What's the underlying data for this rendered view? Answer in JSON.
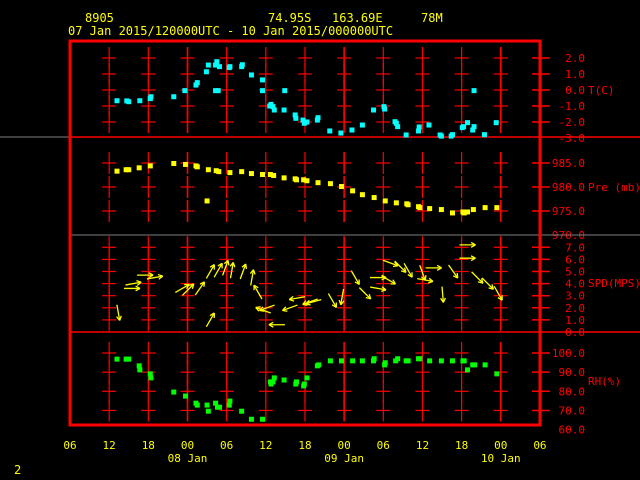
{
  "header": {
    "station": "8905",
    "lat": "74.95S",
    "lon": "163.69E",
    "elev": "78M",
    "period": "07 Jan 2015/120000UTC - 10 Jan 2015/000000UTC"
  },
  "page_number": "2",
  "colors": {
    "frame": "#ff0000",
    "axis_text": "#ff0000",
    "time_text": "#ffff00",
    "temp": "#00ffff",
    "pres": "#ffff00",
    "wind": "#ffff00",
    "rh": "#00ff00"
  },
  "chart_data": {
    "type": "scatter",
    "title": "",
    "x_unit": "hours since 07 Jan 06 UTC",
    "xlim": [
      0,
      72
    ],
    "x_ticks": [
      {
        "h": 0,
        "label": "06"
      },
      {
        "h": 6,
        "label": "12"
      },
      {
        "h": 12,
        "label": "18"
      },
      {
        "h": 18,
        "label": "00"
      },
      {
        "h": 24,
        "label": "06"
      },
      {
        "h": 30,
        "label": "12"
      },
      {
        "h": 36,
        "label": "18"
      },
      {
        "h": 42,
        "label": "00"
      },
      {
        "h": 48,
        "label": "06"
      },
      {
        "h": 54,
        "label": "12"
      },
      {
        "h": 60,
        "label": "18"
      },
      {
        "h": 66,
        "label": "00"
      },
      {
        "h": 72,
        "label": "06"
      }
    ],
    "date_labels": [
      {
        "h": 18,
        "label": "08 Jan"
      },
      {
        "h": 42,
        "label": "09 Jan"
      },
      {
        "h": 66,
        "label": "10 Jan"
      }
    ],
    "panels": [
      {
        "id": "temp",
        "ylabel": "T(C)",
        "ylim": [
          -3,
          3
        ],
        "ticks": [
          "2.0",
          "1.0",
          "0.0",
          "-1.0",
          "-2.0",
          "-3.0"
        ],
        "tick_values": [
          2,
          1,
          0,
          -1,
          -2,
          -3
        ],
        "points": [
          [
            7.2,
            -0.67
          ],
          [
            8.7,
            -0.68
          ],
          [
            9.0,
            -0.73
          ],
          [
            10.7,
            -0.67
          ],
          [
            12.3,
            -0.54
          ],
          [
            12.4,
            -0.42
          ],
          [
            15.9,
            -0.42
          ],
          [
            17.6,
            -0.04
          ],
          [
            19.3,
            0.31
          ],
          [
            19.5,
            0.46
          ],
          [
            20.9,
            1.14
          ],
          [
            21.2,
            1.56
          ],
          [
            22.3,
            1.56
          ],
          [
            22.5,
            1.77
          ],
          [
            22.9,
            1.46
          ],
          [
            22.3,
            -0.04
          ],
          [
            22.7,
            -0.04
          ],
          [
            24.4,
            1.4
          ],
          [
            24.5,
            1.46
          ],
          [
            26.3,
            1.46
          ],
          [
            26.4,
            1.58
          ],
          [
            27.8,
            0.94
          ],
          [
            29.5,
            0.63
          ],
          [
            29.5,
            -0.04
          ],
          [
            30.8,
            -0.9
          ],
          [
            30.6,
            -1.0
          ],
          [
            31.1,
            -1.04
          ],
          [
            31.3,
            -1.25
          ],
          [
            32.9,
            -0.04
          ],
          [
            32.8,
            -1.25
          ],
          [
            34.5,
            -1.56
          ],
          [
            34.6,
            -1.77
          ],
          [
            35.7,
            -1.88
          ],
          [
            35.9,
            -2.08
          ],
          [
            36.3,
            -2.0
          ],
          [
            37.9,
            -1.88
          ],
          [
            38.0,
            -1.73
          ],
          [
            39.8,
            -2.56
          ],
          [
            41.5,
            -2.69
          ],
          [
            43.2,
            -2.5
          ],
          [
            44.8,
            -2.19
          ],
          [
            46.5,
            -1.25
          ],
          [
            48.1,
            -1.04
          ],
          [
            48.2,
            -1.19
          ],
          [
            49.8,
            -1.98
          ],
          [
            50.0,
            -2.08
          ],
          [
            50.2,
            -2.29
          ],
          [
            51.5,
            -2.81
          ],
          [
            53.4,
            -2.56
          ],
          [
            53.5,
            -2.31
          ],
          [
            55.0,
            -2.19
          ],
          [
            56.7,
            -2.81
          ],
          [
            56.9,
            -2.88
          ],
          [
            58.4,
            -2.88
          ],
          [
            58.6,
            -2.79
          ],
          [
            60.1,
            -2.35
          ],
          [
            60.3,
            -2.29
          ],
          [
            60.9,
            -2.04
          ],
          [
            61.7,
            -2.5
          ],
          [
            61.9,
            -2.29
          ],
          [
            61.9,
            -0.04
          ],
          [
            63.5,
            -2.79
          ],
          [
            65.3,
            -2.04
          ]
        ]
      },
      {
        "id": "pres",
        "ylabel": "Pre (mb)",
        "ylim": [
          970,
          990
        ],
        "ticks": [
          "985.0",
          "980.0",
          "975.0",
          "970.0"
        ],
        "tick_values": [
          985,
          980,
          975,
          970
        ],
        "points": [
          [
            7.2,
            983.3
          ],
          [
            8.6,
            983.6
          ],
          [
            9.0,
            983.6
          ],
          [
            10.6,
            984.0
          ],
          [
            12.3,
            984.4
          ],
          [
            15.9,
            984.9
          ],
          [
            17.7,
            984.7
          ],
          [
            19.3,
            984.4
          ],
          [
            19.5,
            984.2
          ],
          [
            21.0,
            977.1
          ],
          [
            21.2,
            983.6
          ],
          [
            22.4,
            983.4
          ],
          [
            22.8,
            983.2
          ],
          [
            24.5,
            983.0
          ],
          [
            26.3,
            983.2
          ],
          [
            27.8,
            982.8
          ],
          [
            29.5,
            982.6
          ],
          [
            30.7,
            982.6
          ],
          [
            31.2,
            982.4
          ],
          [
            32.8,
            981.9
          ],
          [
            34.5,
            981.7
          ],
          [
            34.7,
            981.5
          ],
          [
            35.8,
            981.5
          ],
          [
            36.3,
            981.3
          ],
          [
            38.0,
            980.9
          ],
          [
            39.9,
            980.7
          ],
          [
            41.6,
            980.1
          ],
          [
            43.3,
            979.2
          ],
          [
            44.8,
            978.4
          ],
          [
            46.6,
            977.8
          ],
          [
            48.3,
            977.1
          ],
          [
            50.0,
            976.7
          ],
          [
            51.6,
            976.5
          ],
          [
            51.8,
            976.3
          ],
          [
            53.4,
            975.9
          ],
          [
            53.6,
            975.7
          ],
          [
            55.1,
            975.5
          ],
          [
            56.9,
            975.3
          ],
          [
            58.6,
            974.6
          ],
          [
            60.2,
            974.8
          ],
          [
            60.4,
            974.6
          ],
          [
            60.9,
            974.8
          ],
          [
            61.8,
            975.3
          ],
          [
            63.6,
            975.7
          ],
          [
            65.4,
            975.7
          ]
        ]
      },
      {
        "id": "wind",
        "ylabel": "SPD(MPS)",
        "ylim": [
          0,
          8
        ],
        "ticks": [
          "7.0",
          "6.0",
          "5.0",
          "4.0",
          "3.0",
          "2.0",
          "1.0",
          "0.0"
        ],
        "tick_values": [
          7,
          6,
          5,
          4,
          3,
          2,
          1,
          0
        ],
        "arrows_note": "[hour, speed m/s, direction arrow points toward (deg from north)]",
        "arrows": [
          [
            7.4,
            1.6,
            170
          ],
          [
            9.5,
            3.6,
            90
          ],
          [
            9.7,
            4.0,
            80
          ],
          [
            11.5,
            4.7,
            90
          ],
          [
            13.0,
            4.5,
            80
          ],
          [
            17.2,
            3.6,
            60
          ],
          [
            18.1,
            3.5,
            45
          ],
          [
            19.9,
            3.6,
            35
          ],
          [
            21.5,
            1.0,
            30
          ],
          [
            21.5,
            5.0,
            30
          ],
          [
            22.7,
            5.1,
            30
          ],
          [
            23.8,
            5.3,
            20
          ],
          [
            24.8,
            5.1,
            10
          ],
          [
            26.5,
            5.0,
            20
          ],
          [
            27.9,
            4.5,
            10
          ],
          [
            28.8,
            3.3,
            330
          ],
          [
            29.6,
            1.8,
            290
          ],
          [
            30.2,
            2.0,
            250
          ],
          [
            31.7,
            0.6,
            270
          ],
          [
            33.7,
            2.0,
            250
          ],
          [
            34.8,
            2.8,
            260
          ],
          [
            36.8,
            2.5,
            250
          ],
          [
            37.3,
            2.5,
            255
          ],
          [
            40.2,
            2.6,
            150
          ],
          [
            41.7,
            2.9,
            190
          ],
          [
            43.7,
            4.5,
            150
          ],
          [
            45.2,
            3.2,
            135
          ],
          [
            47.2,
            4.5,
            90
          ],
          [
            47.2,
            3.6,
            100
          ],
          [
            48.8,
            4.3,
            120
          ],
          [
            49.1,
            5.7,
            110
          ],
          [
            50.6,
            5.4,
            135
          ],
          [
            51.8,
            5.1,
            150
          ],
          [
            54.0,
            4.9,
            160
          ],
          [
            54.4,
            4.3,
            100
          ],
          [
            55.7,
            5.3,
            90
          ],
          [
            57.1,
            3.1,
            175
          ],
          [
            58.7,
            5.0,
            145
          ],
          [
            60.9,
            6.1,
            90
          ],
          [
            60.9,
            7.2,
            90
          ],
          [
            62.4,
            4.5,
            135
          ],
          [
            64.0,
            4.0,
            135
          ],
          [
            65.6,
            3.2,
            150
          ]
        ]
      },
      {
        "id": "rh",
        "ylabel": "RH(%)",
        "ylim": [
          60,
          110
        ],
        "ticks": [
          "100.0",
          "90.0",
          "80.0",
          "70.0",
          "60.0"
        ],
        "tick_values": [
          100,
          90,
          80,
          70,
          60
        ],
        "points": [
          [
            7.2,
            96.8
          ],
          [
            8.6,
            96.8
          ],
          [
            9.0,
            96.8
          ],
          [
            10.6,
            93.3
          ],
          [
            10.7,
            91.2
          ],
          [
            12.3,
            89.1
          ],
          [
            12.4,
            87.0
          ],
          [
            15.9,
            79.6
          ],
          [
            17.7,
            77.5
          ],
          [
            19.3,
            73.8
          ],
          [
            19.5,
            72.8
          ],
          [
            21.0,
            72.8
          ],
          [
            21.2,
            69.6
          ],
          [
            22.3,
            73.8
          ],
          [
            22.6,
            71.7
          ],
          [
            22.9,
            71.7
          ],
          [
            24.4,
            72.8
          ],
          [
            24.5,
            74.9
          ],
          [
            26.3,
            69.6
          ],
          [
            27.8,
            65.4
          ],
          [
            29.5,
            65.4
          ],
          [
            30.7,
            84.9
          ],
          [
            30.8,
            83.8
          ],
          [
            31.1,
            84.9
          ],
          [
            31.3,
            87.0
          ],
          [
            32.8,
            85.9
          ],
          [
            34.6,
            83.8
          ],
          [
            34.7,
            84.9
          ],
          [
            35.8,
            82.8
          ],
          [
            35.9,
            83.8
          ],
          [
            36.3,
            87.0
          ],
          [
            37.9,
            93.3
          ],
          [
            38.1,
            93.8
          ],
          [
            39.9,
            95.9
          ],
          [
            41.6,
            95.9
          ],
          [
            43.3,
            95.9
          ],
          [
            44.8,
            95.9
          ],
          [
            46.5,
            95.9
          ],
          [
            46.6,
            97.0
          ],
          [
            48.2,
            93.8
          ],
          [
            48.3,
            94.9
          ],
          [
            49.9,
            95.9
          ],
          [
            50.2,
            97.0
          ],
          [
            51.5,
            95.9
          ],
          [
            51.8,
            95.9
          ],
          [
            53.4,
            97.0
          ],
          [
            53.6,
            97.0
          ],
          [
            55.1,
            95.9
          ],
          [
            56.9,
            95.9
          ],
          [
            58.6,
            95.9
          ],
          [
            60.2,
            95.9
          ],
          [
            60.4,
            95.9
          ],
          [
            60.9,
            91.2
          ],
          [
            61.7,
            93.8
          ],
          [
            62.0,
            93.8
          ],
          [
            63.6,
            93.8
          ],
          [
            65.4,
            89.1
          ]
        ]
      }
    ]
  }
}
